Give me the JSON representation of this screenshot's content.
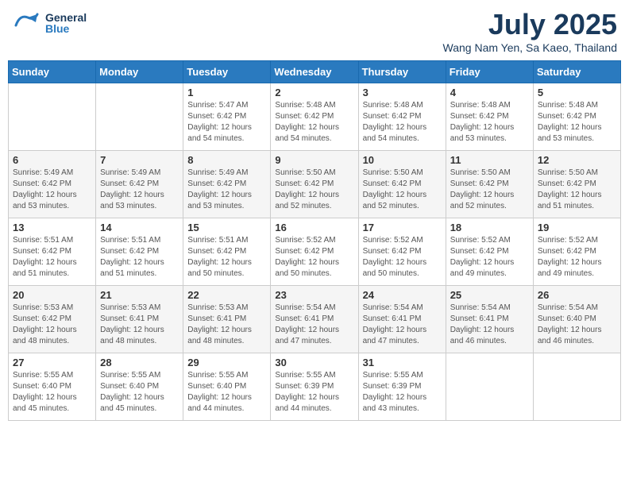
{
  "header": {
    "logo_general": "General",
    "logo_blue": "Blue",
    "month_title": "July 2025",
    "location": "Wang Nam Yen, Sa Kaeo, Thailand"
  },
  "calendar": {
    "days_of_week": [
      "Sunday",
      "Monday",
      "Tuesday",
      "Wednesday",
      "Thursday",
      "Friday",
      "Saturday"
    ],
    "weeks": [
      [
        {
          "day": "",
          "info": ""
        },
        {
          "day": "",
          "info": ""
        },
        {
          "day": "1",
          "info": "Sunrise: 5:47 AM\nSunset: 6:42 PM\nDaylight: 12 hours\nand 54 minutes."
        },
        {
          "day": "2",
          "info": "Sunrise: 5:48 AM\nSunset: 6:42 PM\nDaylight: 12 hours\nand 54 minutes."
        },
        {
          "day": "3",
          "info": "Sunrise: 5:48 AM\nSunset: 6:42 PM\nDaylight: 12 hours\nand 54 minutes."
        },
        {
          "day": "4",
          "info": "Sunrise: 5:48 AM\nSunset: 6:42 PM\nDaylight: 12 hours\nand 53 minutes."
        },
        {
          "day": "5",
          "info": "Sunrise: 5:48 AM\nSunset: 6:42 PM\nDaylight: 12 hours\nand 53 minutes."
        }
      ],
      [
        {
          "day": "6",
          "info": "Sunrise: 5:49 AM\nSunset: 6:42 PM\nDaylight: 12 hours\nand 53 minutes."
        },
        {
          "day": "7",
          "info": "Sunrise: 5:49 AM\nSunset: 6:42 PM\nDaylight: 12 hours\nand 53 minutes."
        },
        {
          "day": "8",
          "info": "Sunrise: 5:49 AM\nSunset: 6:42 PM\nDaylight: 12 hours\nand 53 minutes."
        },
        {
          "day": "9",
          "info": "Sunrise: 5:50 AM\nSunset: 6:42 PM\nDaylight: 12 hours\nand 52 minutes."
        },
        {
          "day": "10",
          "info": "Sunrise: 5:50 AM\nSunset: 6:42 PM\nDaylight: 12 hours\nand 52 minutes."
        },
        {
          "day": "11",
          "info": "Sunrise: 5:50 AM\nSunset: 6:42 PM\nDaylight: 12 hours\nand 52 minutes."
        },
        {
          "day": "12",
          "info": "Sunrise: 5:50 AM\nSunset: 6:42 PM\nDaylight: 12 hours\nand 51 minutes."
        }
      ],
      [
        {
          "day": "13",
          "info": "Sunrise: 5:51 AM\nSunset: 6:42 PM\nDaylight: 12 hours\nand 51 minutes."
        },
        {
          "day": "14",
          "info": "Sunrise: 5:51 AM\nSunset: 6:42 PM\nDaylight: 12 hours\nand 51 minutes."
        },
        {
          "day": "15",
          "info": "Sunrise: 5:51 AM\nSunset: 6:42 PM\nDaylight: 12 hours\nand 50 minutes."
        },
        {
          "day": "16",
          "info": "Sunrise: 5:52 AM\nSunset: 6:42 PM\nDaylight: 12 hours\nand 50 minutes."
        },
        {
          "day": "17",
          "info": "Sunrise: 5:52 AM\nSunset: 6:42 PM\nDaylight: 12 hours\nand 50 minutes."
        },
        {
          "day": "18",
          "info": "Sunrise: 5:52 AM\nSunset: 6:42 PM\nDaylight: 12 hours\nand 49 minutes."
        },
        {
          "day": "19",
          "info": "Sunrise: 5:52 AM\nSunset: 6:42 PM\nDaylight: 12 hours\nand 49 minutes."
        }
      ],
      [
        {
          "day": "20",
          "info": "Sunrise: 5:53 AM\nSunset: 6:42 PM\nDaylight: 12 hours\nand 48 minutes."
        },
        {
          "day": "21",
          "info": "Sunrise: 5:53 AM\nSunset: 6:41 PM\nDaylight: 12 hours\nand 48 minutes."
        },
        {
          "day": "22",
          "info": "Sunrise: 5:53 AM\nSunset: 6:41 PM\nDaylight: 12 hours\nand 48 minutes."
        },
        {
          "day": "23",
          "info": "Sunrise: 5:54 AM\nSunset: 6:41 PM\nDaylight: 12 hours\nand 47 minutes."
        },
        {
          "day": "24",
          "info": "Sunrise: 5:54 AM\nSunset: 6:41 PM\nDaylight: 12 hours\nand 47 minutes."
        },
        {
          "day": "25",
          "info": "Sunrise: 5:54 AM\nSunset: 6:41 PM\nDaylight: 12 hours\nand 46 minutes."
        },
        {
          "day": "26",
          "info": "Sunrise: 5:54 AM\nSunset: 6:40 PM\nDaylight: 12 hours\nand 46 minutes."
        }
      ],
      [
        {
          "day": "27",
          "info": "Sunrise: 5:55 AM\nSunset: 6:40 PM\nDaylight: 12 hours\nand 45 minutes."
        },
        {
          "day": "28",
          "info": "Sunrise: 5:55 AM\nSunset: 6:40 PM\nDaylight: 12 hours\nand 45 minutes."
        },
        {
          "day": "29",
          "info": "Sunrise: 5:55 AM\nSunset: 6:40 PM\nDaylight: 12 hours\nand 44 minutes."
        },
        {
          "day": "30",
          "info": "Sunrise: 5:55 AM\nSunset: 6:39 PM\nDaylight: 12 hours\nand 44 minutes."
        },
        {
          "day": "31",
          "info": "Sunrise: 5:55 AM\nSunset: 6:39 PM\nDaylight: 12 hours\nand 43 minutes."
        },
        {
          "day": "",
          "info": ""
        },
        {
          "day": "",
          "info": ""
        }
      ]
    ]
  }
}
